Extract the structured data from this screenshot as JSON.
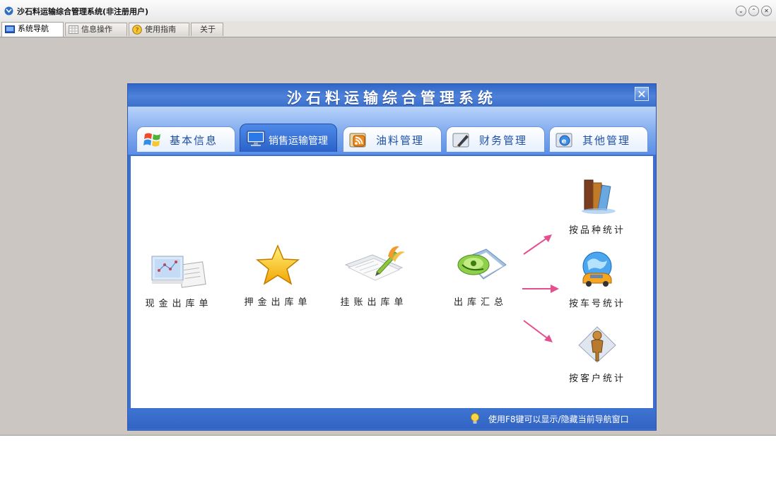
{
  "window": {
    "title": "沙石料运输综合管理系统(非注册用户)",
    "buttons": [
      "⌄",
      "⌃",
      "✕"
    ]
  },
  "top_tabs": [
    {
      "label": "系统导航",
      "icon": "monitor-icon",
      "active": true
    },
    {
      "label": "信息操作",
      "icon": "grid-icon",
      "active": false
    },
    {
      "label": "使用指南",
      "icon": "help-icon",
      "active": false
    },
    {
      "label": "关于",
      "icon": "",
      "active": false
    }
  ],
  "dialog": {
    "title": "沙石料运输综合管理系统",
    "close": "✕",
    "tabs": [
      {
        "label": "基本信息",
        "icon": "windows-logo-icon",
        "active": false
      },
      {
        "label": "销售运输管理",
        "icon": "monitor-icon",
        "active": true
      },
      {
        "label": "油料管理",
        "icon": "rss-icon",
        "active": false
      },
      {
        "label": "财务管理",
        "icon": "pen-icon",
        "active": false
      },
      {
        "label": "其他管理",
        "icon": "globe-ie-icon",
        "active": false
      }
    ],
    "items": [
      {
        "label": "现金出库单",
        "icon": "chart-document-icon"
      },
      {
        "label": "押金出库单",
        "icon": "star-icon"
      },
      {
        "label": "挂账出库单",
        "icon": "edit-document-icon"
      },
      {
        "label": "出库汇总",
        "icon": "summary-disc-icon"
      }
    ],
    "stats": [
      {
        "label": "按品种统计",
        "icon": "books-icon"
      },
      {
        "label": "按车号统计",
        "icon": "globe-car-icon"
      },
      {
        "label": "按客户统计",
        "icon": "person-icon"
      }
    ],
    "status_text": "使用F8键可以显示/隐藏当前导航窗口",
    "accent": "#3c6fcf",
    "arrow_color": "#e64f8f"
  }
}
